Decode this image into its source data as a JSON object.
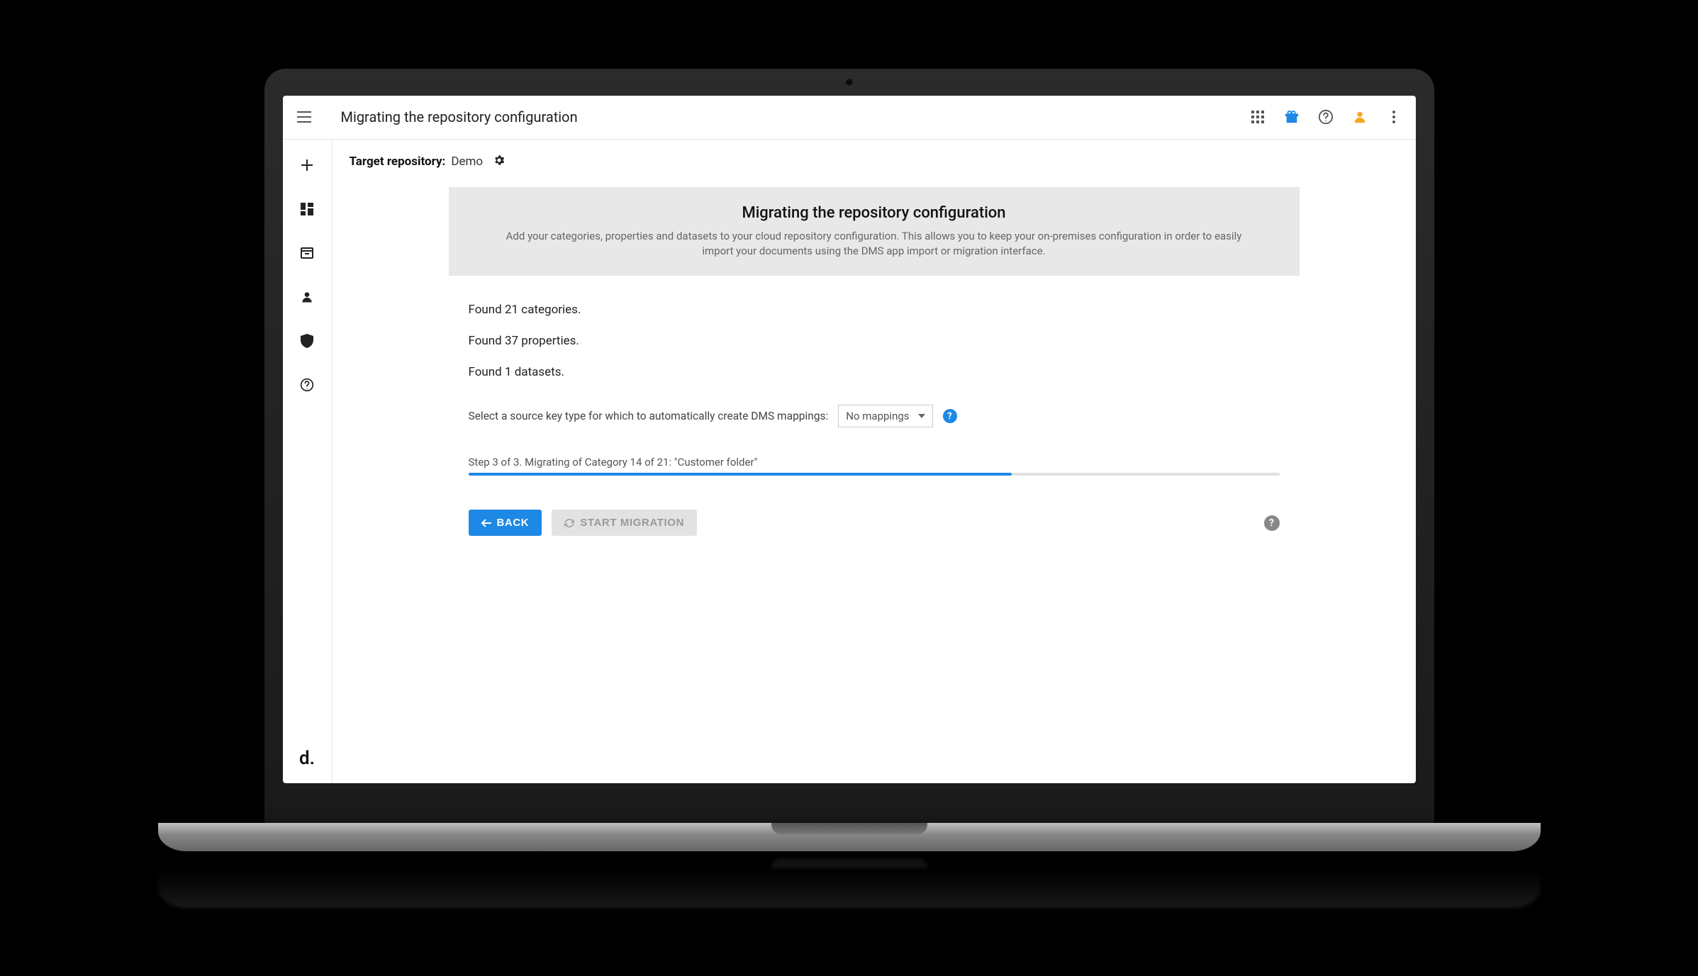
{
  "header": {
    "title": "Migrating the repository configuration"
  },
  "target": {
    "label": "Target repository:",
    "value": "Demo"
  },
  "panel": {
    "title": "Migrating the repository configuration",
    "description": "Add your categories, properties and datasets to your cloud repository configuration. This allows you to keep your on-premises configuration in order to easily import your documents using the DMS app import or migration interface."
  },
  "summary": {
    "categories": "Found 21 categories.",
    "properties": "Found 37 properties.",
    "datasets": "Found 1 datasets."
  },
  "mapping": {
    "label": "Select a source key type for which to automatically create DMS mappings:",
    "selected": "No mappings"
  },
  "progress": {
    "label": "Step 3 of 3. Migrating of Category 14 of 21: \"Customer folder\"",
    "percent": 67
  },
  "actions": {
    "back": "BACK",
    "start": "START MIGRATION"
  },
  "sidebar": {
    "logo": "d."
  }
}
